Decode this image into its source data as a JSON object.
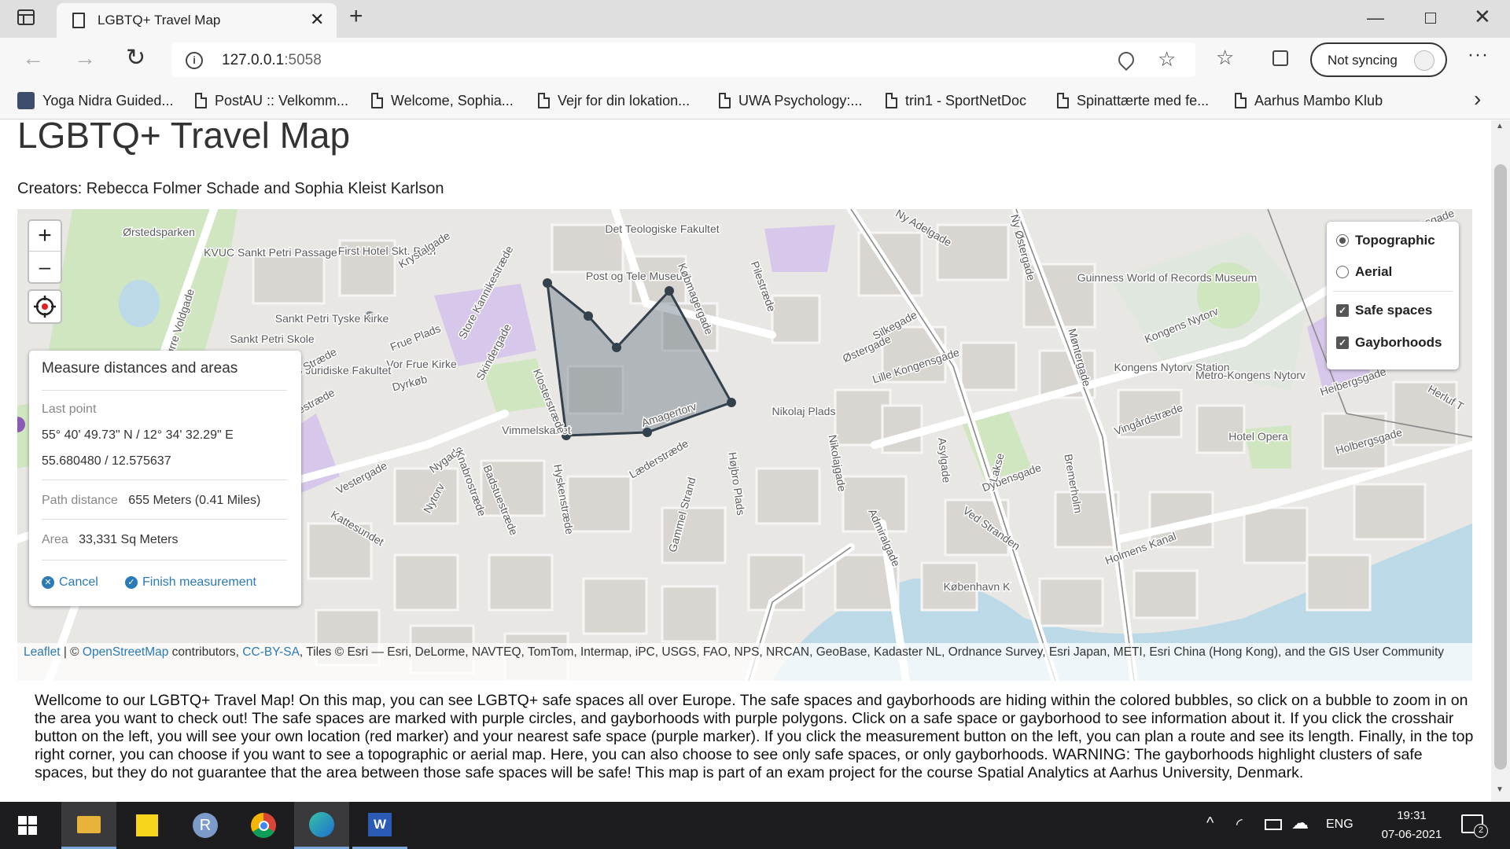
{
  "browser": {
    "tab_title": "LGBTQ+ Travel Map",
    "url_host": "127.0.0.1",
    "url_port": ":5058",
    "sync_label": "Not syncing",
    "bookmarks": [
      {
        "label": "Yoga Nidra Guided..."
      },
      {
        "label": "PostAU :: Velkomm..."
      },
      {
        "label": "Welcome, Sophia..."
      },
      {
        "label": "Vejr for din lokation..."
      },
      {
        "label": "UWA Psychology:..."
      },
      {
        "label": "trin1 - SportNetDoc"
      },
      {
        "label": "Spinattærte med fe..."
      },
      {
        "label": "Aarhus Mambo Klub"
      }
    ]
  },
  "page": {
    "title": "LGBTQ+ Travel Map",
    "creators": "Creators: Rebecca Folmer Schade and Sophia Kleist Karlson",
    "description": "Wellcome to our LGBTQ+ Travel Map! On this map, you can see LGBTQ+ safe spaces all over Europe. The safe spaces and gayborhoods are hiding within the colored bubbles, so click on a bubble to zoom in on the area you want to check out! The safe spaces are marked with purple circles, and gayborhoods with purple polygons. Click on a safe space or gayborhood to see information about it. If you click the crosshair button on the left, you will see your own location (red marker) and your nearest safe space (purple marker). If you click the measurement button on the left, you can plan a route and see its length. Finally, in the top right corner, you can choose if you want to see a topographic or aerial map. Here, you can also choose to see only safe spaces, or only gayborhoods. WARNING: The gayborhoods highlight clusters of safe spaces, but they do not guarantee that the area between those safe spaces will be safe! This map is part of an exam project for the course Spatial Analytics at Aarhus University, Denmark."
  },
  "map": {
    "zoom_in": "+",
    "zoom_out": "–",
    "layers": {
      "base": [
        {
          "label": "Topographic",
          "checked": true
        },
        {
          "label": "Aerial",
          "checked": false
        }
      ],
      "overlays": [
        {
          "label": "Safe spaces",
          "checked": true
        },
        {
          "label": "Gayborhoods",
          "checked": true
        }
      ]
    },
    "measure": {
      "heading": "Measure distances and areas",
      "last_point_label": "Last point",
      "dms": "55° 40' 49.73\" N / 12° 34' 32.29\" E",
      "decimal": "55.680480 / 12.575637",
      "path_label": "Path distance",
      "path_value": "655 Meters (0.41 Miles)",
      "area_label": "Area",
      "area_value": "33,331 Sq Meters",
      "cancel": "Cancel",
      "finish": "Finish measurement"
    },
    "attribution": {
      "leaflet": "Leaflet",
      "sep": " | © ",
      "osm": "OpenStreetMap",
      "contrib": " contributors, ",
      "ccbysa": "CC-BY-SA",
      "tiles": ", Tiles © Esri — Esri, DeLorme, NAVTEQ, TomTom, Intermap, iPC, USGS, FAO, NPS, NRCAN, GeoBase, Kadaster NL, Ordnance Survey, Esri Japan, METI, Esri China (Hong Kong), and the GIS User Community"
    },
    "labels": [
      "Ørstedsparken",
      "KVUC Sankt Petri Passage",
      "First Hotel Skt. Petri",
      "Krystalgade",
      "Det Teologiske Fakultet",
      "Ny Adelgade",
      "Post og Tele Museum",
      "Guinness World of Records Museum",
      "Sankt Petri Tyske Kirke",
      "Sankt Petri Skole",
      "Frue Plads",
      "Vor Frue Kirke",
      "Det Juridiske Fakultet",
      "Dyrkøb",
      "Silkegade",
      "Østergade",
      "Lille Kongensgade",
      "Kongens Nytorv",
      "Kongens Nytorv Station",
      "Metro-Kongens Nytorv",
      "Nikolaj Plads",
      "Vimmelskaftet",
      "Amagertorv",
      "Læderstræde",
      "Hotel Opera",
      "Holbergsgade",
      "Vestergade",
      "Nygade",
      "Nytorv",
      "Badstuestræde",
      "Holmens Kanal",
      "København K",
      "Bremerholm",
      "Vingårdstræde",
      "Dybensgade",
      "Ved Stranden",
      "Studiestræde",
      "Larsbjørnsstræde",
      "Sankt Peders Stræde",
      "Knabrostræde",
      "Kattesundet",
      "Klosterstræde",
      "Skindergade",
      "Store Kannikestræde",
      "Købmagergade",
      "Pilestræde",
      "Højbro Plads",
      "Admiralgade",
      "Nikolajgade",
      "Asylgade",
      "Heibergsgade",
      "Herluf T",
      "Store Kongensgade",
      "Gammel Strand",
      "Hyskenstræde",
      "Lakse",
      "Ny Østergade",
      "Møntergade",
      "Nørre Voldgade"
    ]
  },
  "taskbar": {
    "lang": "ENG",
    "time": "19:31",
    "date": "07-06-2021",
    "notif_count": "2"
  },
  "colors": {
    "measure_fill": "#6b7a86",
    "measure_line": "#33414d",
    "link": "#2a7ab8",
    "park": "#cfe6c0",
    "purple": "#d7c7ea"
  }
}
